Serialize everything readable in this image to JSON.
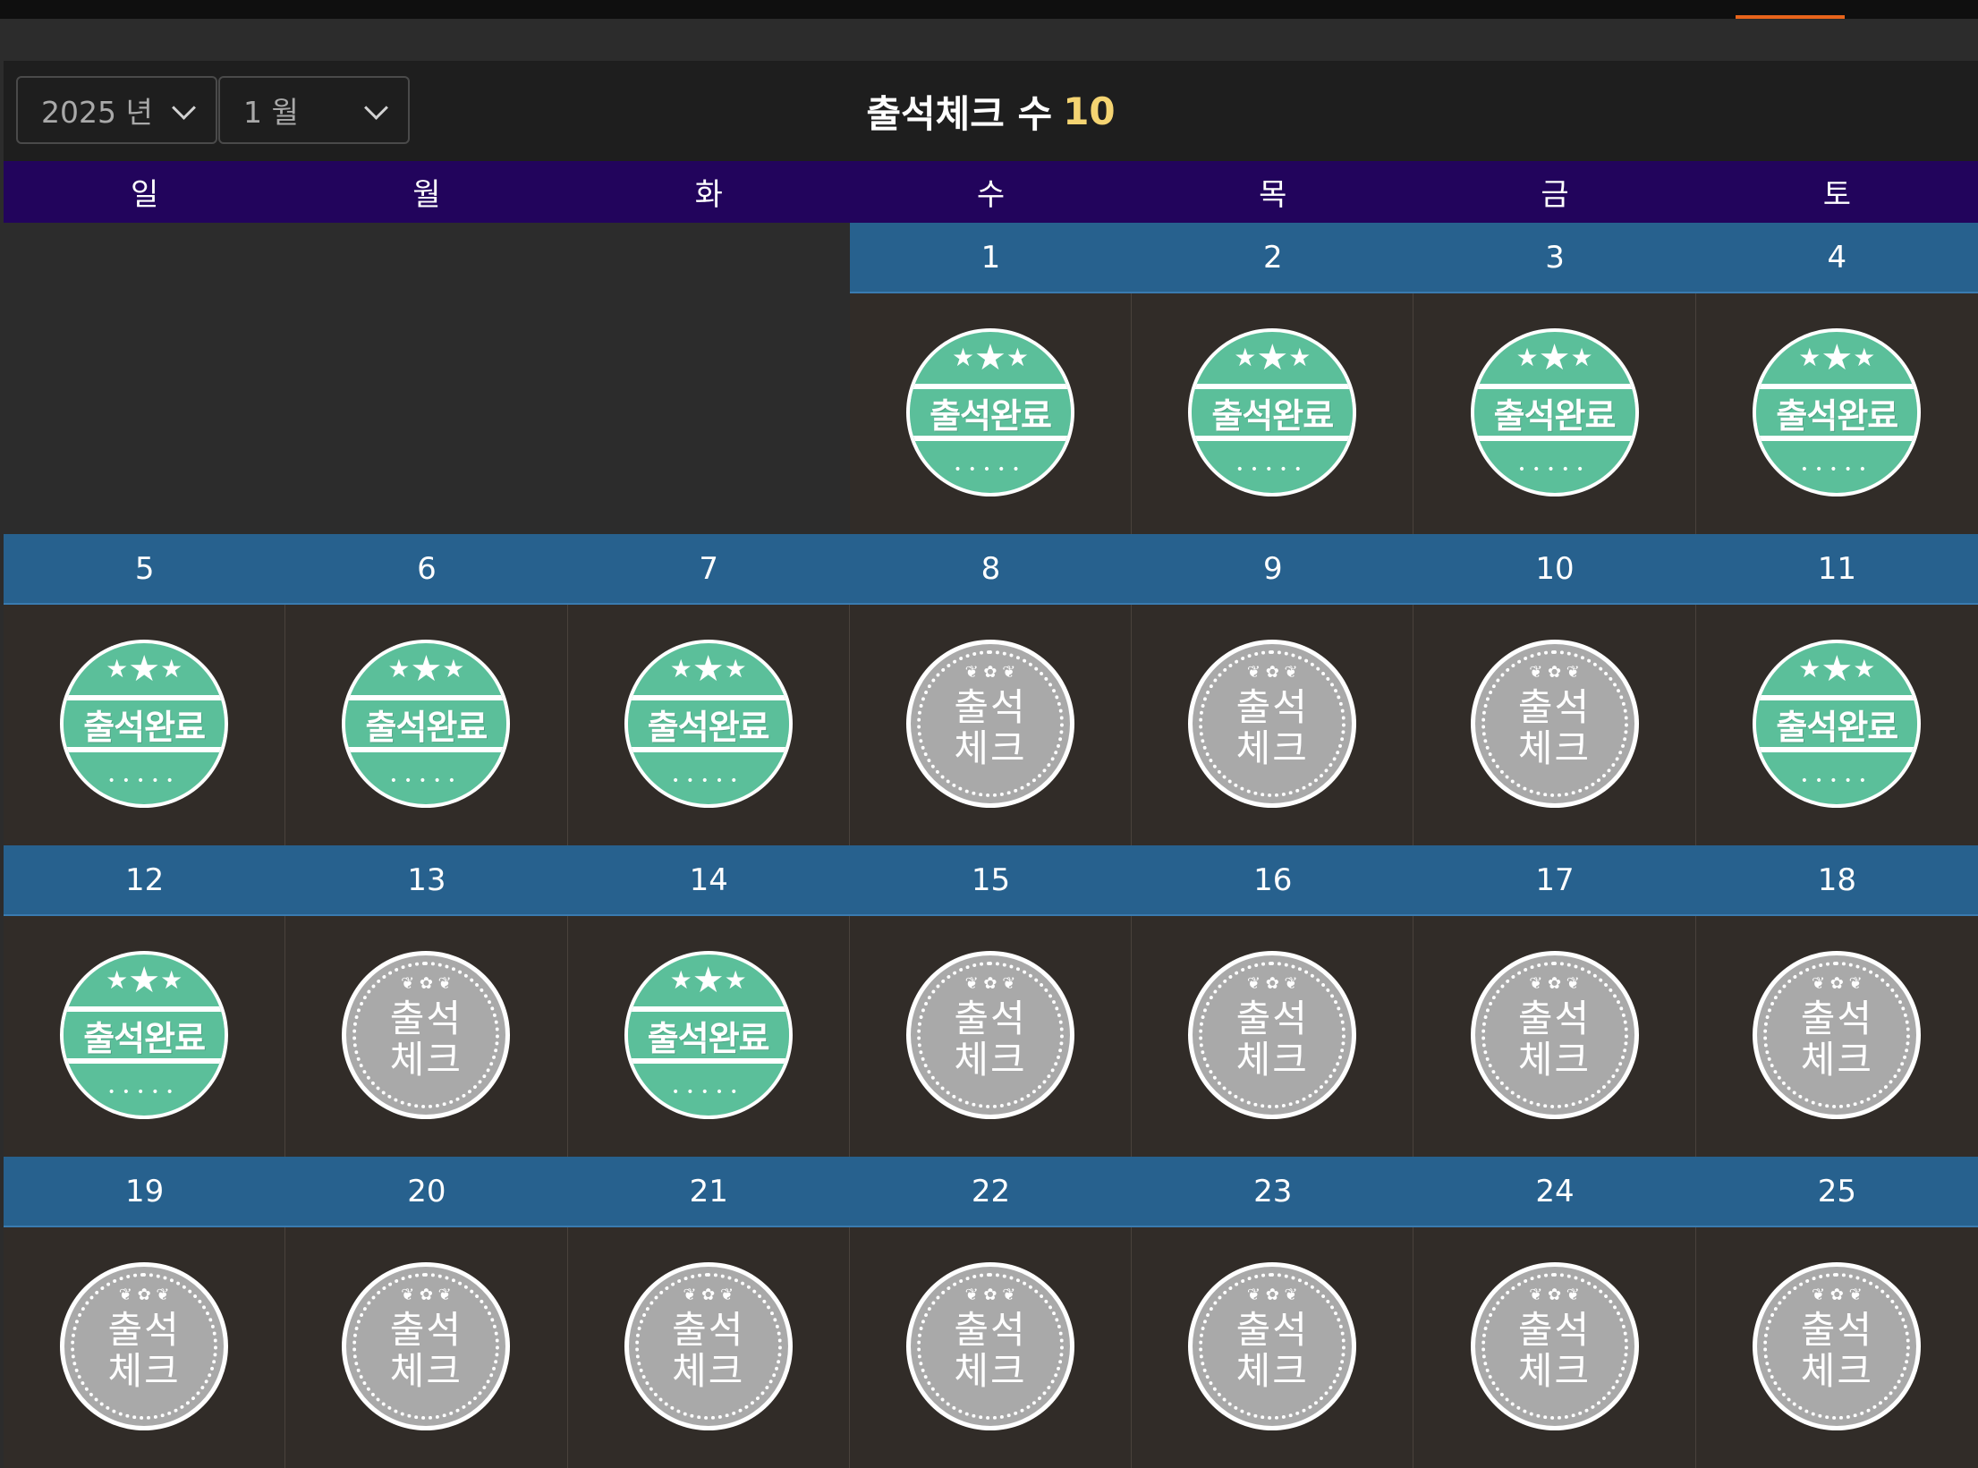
{
  "header": {
    "year_label": "2025 년",
    "month_label": "1 월",
    "title": "출석체크 수",
    "count": "10"
  },
  "weekdays": [
    "일",
    "월",
    "화",
    "수",
    "목",
    "금",
    "토"
  ],
  "stamp_labels": {
    "done": "출석완료",
    "pending_line1": "출석",
    "pending_line2": "체크"
  },
  "weeks": [
    [
      {
        "day": "",
        "status": "empty"
      },
      {
        "day": "",
        "status": "empty"
      },
      {
        "day": "",
        "status": "empty"
      },
      {
        "day": "1",
        "status": "done"
      },
      {
        "day": "2",
        "status": "done"
      },
      {
        "day": "3",
        "status": "done"
      },
      {
        "day": "4",
        "status": "done"
      }
    ],
    [
      {
        "day": "5",
        "status": "done"
      },
      {
        "day": "6",
        "status": "done"
      },
      {
        "day": "7",
        "status": "done"
      },
      {
        "day": "8",
        "status": "pending"
      },
      {
        "day": "9",
        "status": "pending"
      },
      {
        "day": "10",
        "status": "pending"
      },
      {
        "day": "11",
        "status": "done"
      }
    ],
    [
      {
        "day": "12",
        "status": "done"
      },
      {
        "day": "13",
        "status": "pending"
      },
      {
        "day": "14",
        "status": "done"
      },
      {
        "day": "15",
        "status": "pending"
      },
      {
        "day": "16",
        "status": "pending"
      },
      {
        "day": "17",
        "status": "pending"
      },
      {
        "day": "18",
        "status": "pending"
      }
    ],
    [
      {
        "day": "19",
        "status": "pending"
      },
      {
        "day": "20",
        "status": "pending"
      },
      {
        "day": "21",
        "status": "pending"
      },
      {
        "day": "22",
        "status": "pending"
      },
      {
        "day": "23",
        "status": "pending"
      },
      {
        "day": "24",
        "status": "pending"
      },
      {
        "day": "25",
        "status": "pending"
      }
    ]
  ],
  "colors": {
    "weekday_bar": "#22045c",
    "day_number_bar": "#27618e",
    "done_stamp": "#5bbf9a",
    "pending_stamp": "#a9a9a9",
    "count_highlight": "#f5d472",
    "active_tab_indicator": "#e8641b"
  }
}
